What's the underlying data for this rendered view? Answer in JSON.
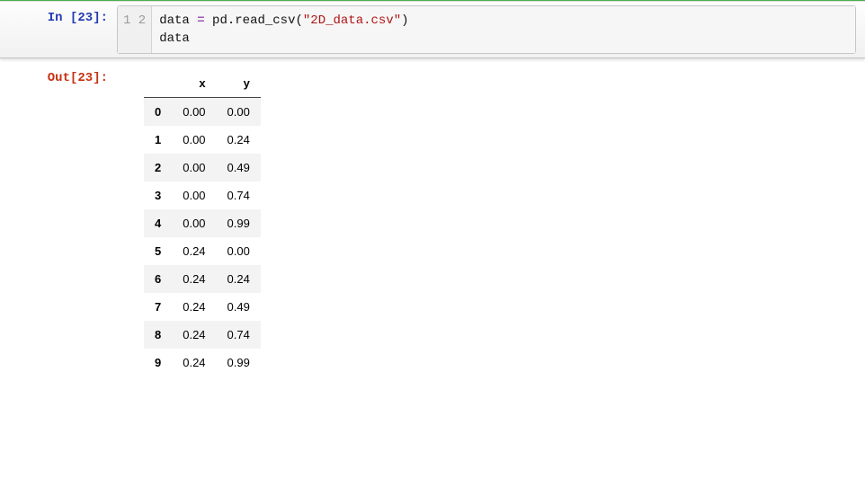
{
  "input": {
    "prompt": "In [23]:",
    "gutter": [
      "1",
      "2"
    ],
    "code_tokens": [
      [
        {
          "t": "data ",
          "c": "tok-var"
        },
        {
          "t": "=",
          "c": "tok-op"
        },
        {
          "t": " pd",
          "c": "tok-var"
        },
        {
          "t": ".",
          "c": "tok-punc"
        },
        {
          "t": "read_csv",
          "c": "tok-var"
        },
        {
          "t": "(",
          "c": "tok-punc"
        },
        {
          "t": "\"2D_data.csv\"",
          "c": "tok-str"
        },
        {
          "t": ")",
          "c": "tok-punc"
        }
      ],
      [
        {
          "t": "data",
          "c": "tok-var"
        }
      ]
    ]
  },
  "output": {
    "prompt": "Out[23]:",
    "table": {
      "columns": [
        "x",
        "y"
      ],
      "rows": [
        {
          "idx": "0",
          "x": "0.00",
          "y": "0.00"
        },
        {
          "idx": "1",
          "x": "0.00",
          "y": "0.24"
        },
        {
          "idx": "2",
          "x": "0.00",
          "y": "0.49"
        },
        {
          "idx": "3",
          "x": "0.00",
          "y": "0.74"
        },
        {
          "idx": "4",
          "x": "0.00",
          "y": "0.99"
        },
        {
          "idx": "5",
          "x": "0.24",
          "y": "0.00"
        },
        {
          "idx": "6",
          "x": "0.24",
          "y": "0.24"
        },
        {
          "idx": "7",
          "x": "0.24",
          "y": "0.49"
        },
        {
          "idx": "8",
          "x": "0.24",
          "y": "0.74"
        },
        {
          "idx": "9",
          "x": "0.24",
          "y": "0.99"
        }
      ]
    }
  },
  "chart_data": {
    "type": "table",
    "title": "",
    "columns": [
      "x",
      "y"
    ],
    "index": [
      0,
      1,
      2,
      3,
      4,
      5,
      6,
      7,
      8,
      9
    ],
    "data": [
      [
        0.0,
        0.0
      ],
      [
        0.0,
        0.24
      ],
      [
        0.0,
        0.49
      ],
      [
        0.0,
        0.74
      ],
      [
        0.0,
        0.99
      ],
      [
        0.24,
        0.0
      ],
      [
        0.24,
        0.24
      ],
      [
        0.24,
        0.49
      ],
      [
        0.24,
        0.74
      ],
      [
        0.24,
        0.99
      ]
    ]
  }
}
